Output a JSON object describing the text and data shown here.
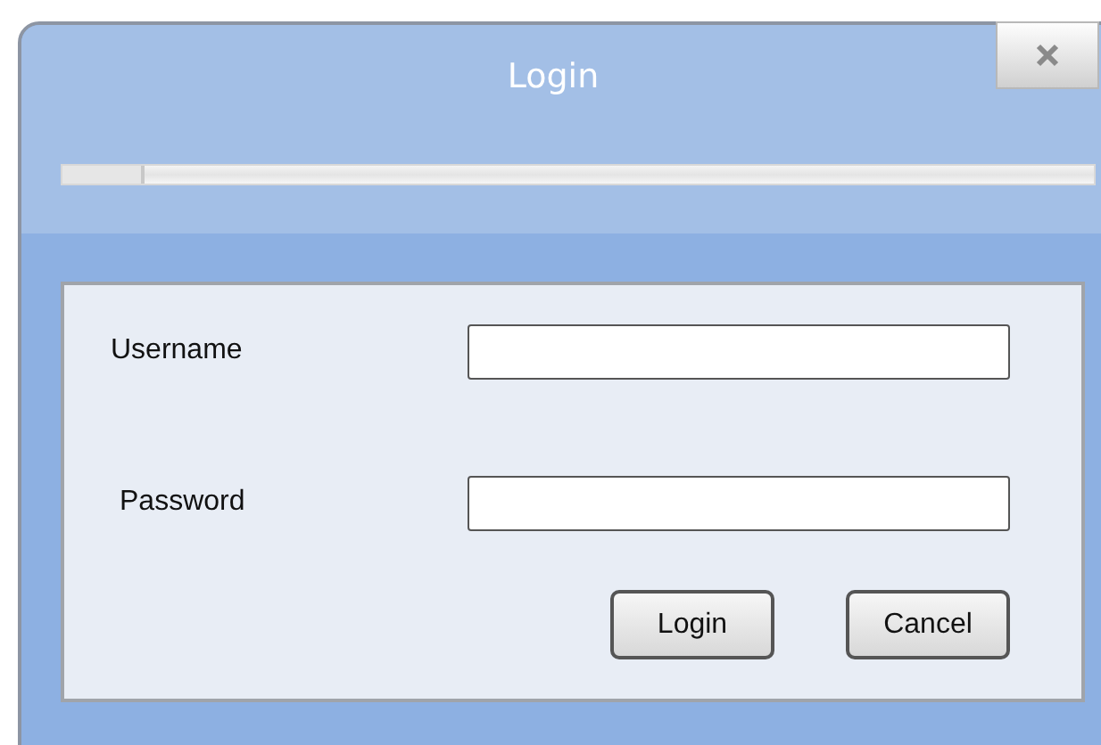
{
  "window": {
    "title": "Login"
  },
  "progress": {
    "level": 0.08
  },
  "fields": [
    {
      "label": "Username"
    },
    {
      "label": "Password"
    }
  ],
  "buttons": [
    "Login",
    "Cancel"
  ]
}
